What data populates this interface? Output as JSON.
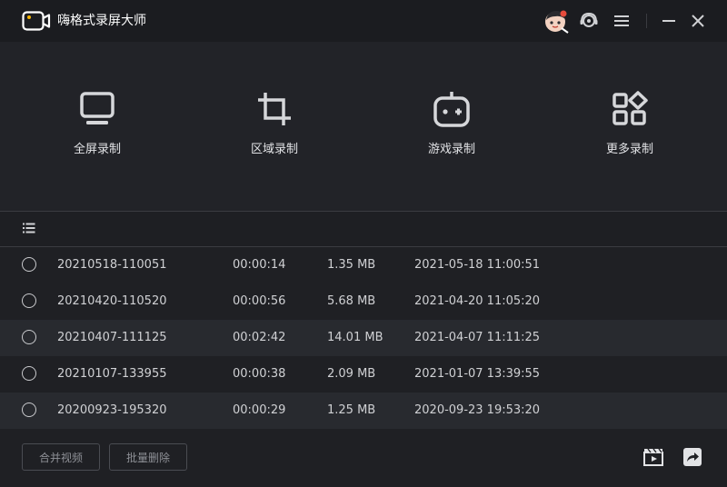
{
  "window": {
    "title": "嗨格式录屏大师",
    "icons": [
      "video-camera-logo-icon",
      "user-avatar-icon",
      "headset-support-icon",
      "menu-icon",
      "minimize-icon",
      "close-icon"
    ]
  },
  "modes": [
    {
      "label": "全屏录制",
      "icon": "monitor-icon"
    },
    {
      "label": "区域录制",
      "icon": "crop-icon"
    },
    {
      "label": "游戏录制",
      "icon": "game-controller-icon"
    },
    {
      "label": "更多录制",
      "icon": "apps-grid-icon"
    }
  ],
  "list_toolbar": {
    "icon": "list-icon"
  },
  "recordings": [
    {
      "name": "20210518-110051",
      "duration": "00:00:14",
      "size": "1.35 MB",
      "date": "2021-05-18 11:00:51"
    },
    {
      "name": "20210420-110520",
      "duration": "00:00:56",
      "size": "5.68 MB",
      "date": "2021-04-20 11:05:20"
    },
    {
      "name": "20210407-111125",
      "duration": "00:02:42",
      "size": "14.01 MB",
      "date": "2021-04-07 11:11:25"
    },
    {
      "name": "20210107-133955",
      "duration": "00:00:38",
      "size": "2.09 MB",
      "date": "2021-01-07 13:39:55"
    },
    {
      "name": "20200923-195320",
      "duration": "00:00:29",
      "size": "1.25 MB",
      "date": "2020-09-23 19:53:20"
    }
  ],
  "footer": {
    "merge_label": "合并视频",
    "batch_delete_label": "批量删除",
    "icons": [
      "video-clip-icon",
      "share-icon"
    ]
  },
  "colors": {
    "background": "#1f2024",
    "titlebar": "#1b1c20",
    "row_alt": "#282a2f",
    "text": "#d6d7da"
  }
}
